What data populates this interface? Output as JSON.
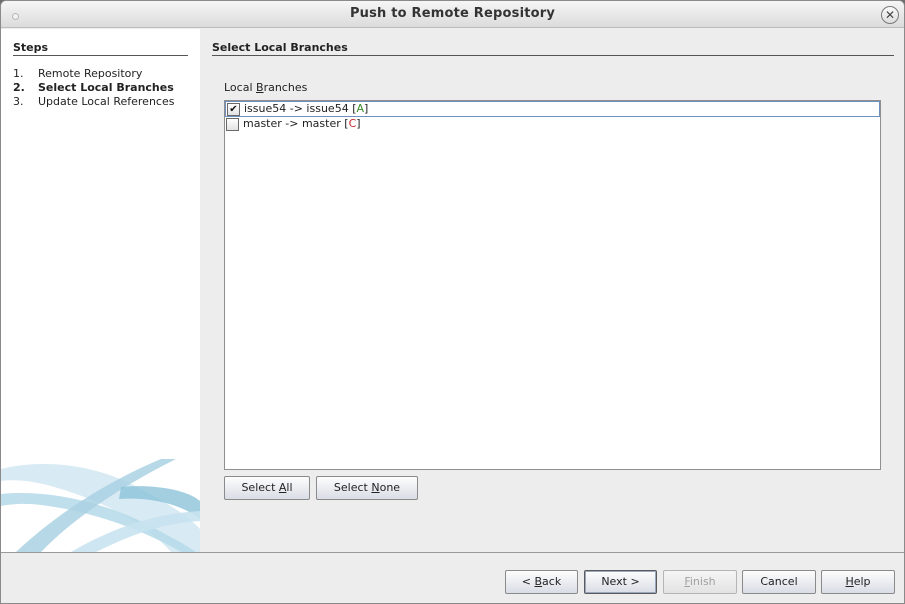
{
  "window": {
    "title": "Push to Remote Repository",
    "close_glyph": "✕"
  },
  "steps": {
    "title": "Steps",
    "items": [
      {
        "num": "1.",
        "label": "Remote Repository",
        "current": false
      },
      {
        "num": "2.",
        "label": "Select Local Branches",
        "current": true
      },
      {
        "num": "3.",
        "label": "Update Local References",
        "current": false
      }
    ]
  },
  "panel": {
    "title": "Select Local Branches",
    "list_label_pre": "Local ",
    "list_label_mnemonic": "B",
    "list_label_post": "ranches"
  },
  "branches": [
    {
      "checked": true,
      "text": "issue54 -> issue54 ",
      "tag_open": "[",
      "tag": "A",
      "tag_close": "]",
      "tag_color": "#3a8a2a"
    },
    {
      "checked": false,
      "text": "master -> master ",
      "tag_open": "[",
      "tag": "C",
      "tag_close": "]",
      "tag_color": "#c62828"
    }
  ],
  "list_buttons": {
    "select_all_pre": "Select ",
    "select_all_mn": "A",
    "select_all_post": "ll",
    "select_none_pre": "Select ",
    "select_none_mn": "N",
    "select_none_post": "one"
  },
  "footer_buttons": {
    "back_pre": "< ",
    "back_mn": "B",
    "back_post": "ack",
    "next": "Next >",
    "finish_mn": "F",
    "finish_post": "inish",
    "cancel": "Cancel",
    "help_mn": "H",
    "help_post": "elp"
  },
  "icons": {
    "check": "✔"
  },
  "colors": {
    "accent_decor": "#9fcbe0",
    "tag_added": "#3a8a2a",
    "tag_conflict": "#c62828"
  }
}
